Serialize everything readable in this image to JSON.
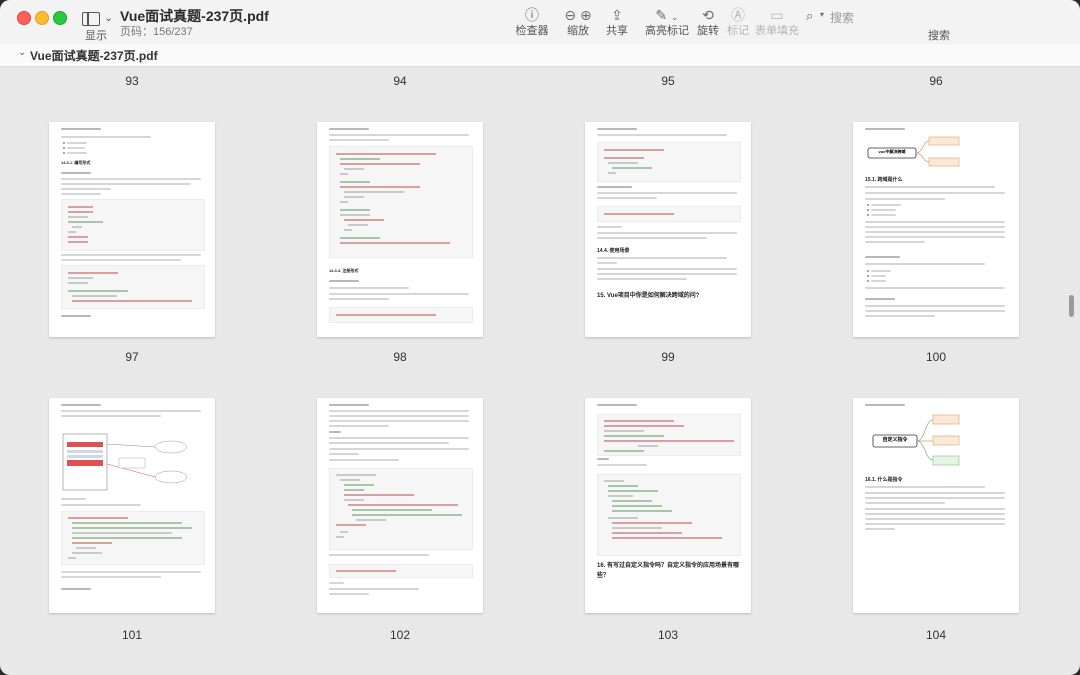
{
  "window": {
    "title": "Vue面试真题-237页.pdf",
    "subtitle": "页码：156/237"
  },
  "toolbar": {
    "sidebar_label": "显示",
    "inspector_label": "检查器",
    "zoom_label": "缩放",
    "share_label": "共享",
    "markup_label": "高亮标记",
    "rotate_label": "旋转",
    "annotate_label": "标记",
    "form_label": "表单填充",
    "search_label": "搜索",
    "search_placeholder": "搜索"
  },
  "pathbar": {
    "filename": "Vue面试真题-237页.pdf"
  },
  "pages": {
    "p93": "93",
    "p94": "94",
    "p95": "95",
    "p96": "96",
    "p97": "97",
    "p98": "98",
    "p99": "99",
    "p100": "100",
    "p101": "101",
    "p102": "102",
    "p103": "103",
    "p104": "104"
  },
  "page_headings": {
    "p99": "15. Vue项目中你是如何解决跨域的问?",
    "p103_a": "16. 有写过自定义指令吗？自定义指令的应用场景有哪",
    "p103_b": "些？",
    "p100_title": "vue中解决跨域",
    "p104_title": "自定义指令",
    "p104_sub": "16.1. 什么是指令",
    "p100_sub": "15.1. 跨域是什么",
    "p97_h1": "14.3.1. 编写形式",
    "p98_h1": "14.3.3. 注册形式",
    "p99_h1": "14.4. 使用场景"
  }
}
